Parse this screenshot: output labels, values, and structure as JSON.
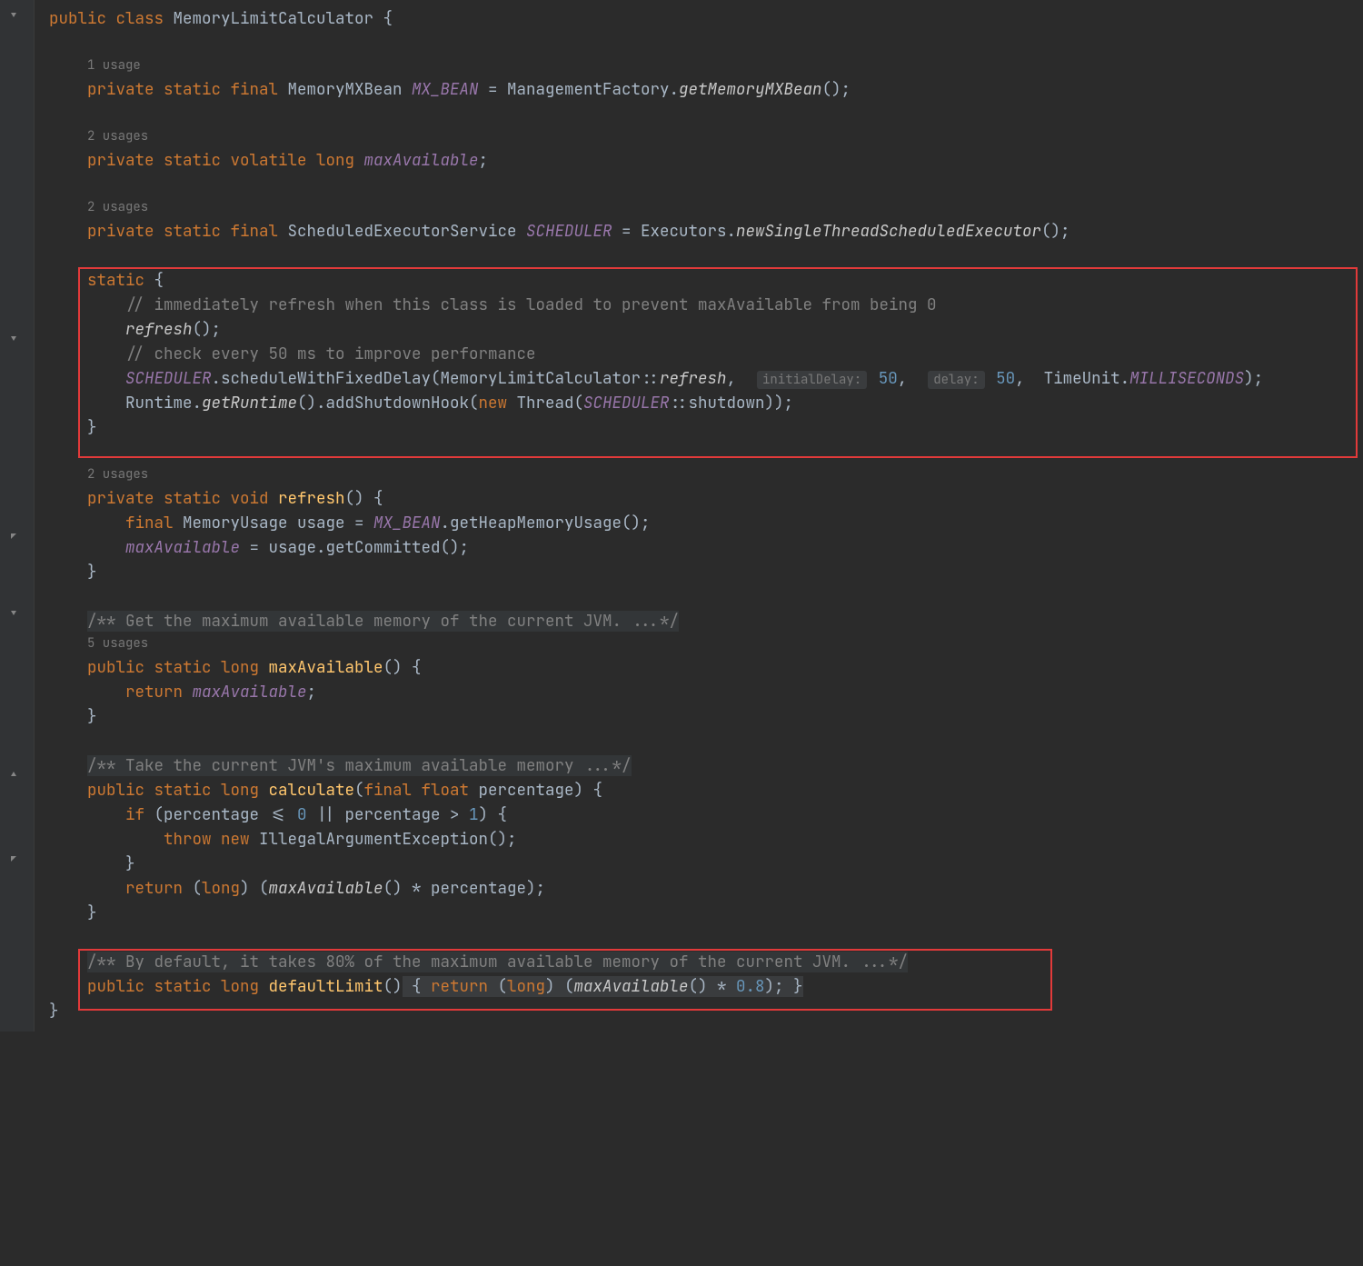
{
  "usages": {
    "u1": "1 usage",
    "u2a": "2 usages",
    "u2b": "2 usages",
    "u2c": "2 usages",
    "u5": "5 usages"
  },
  "code": {
    "l1_public": "public",
    "l1_class": "class",
    "l1_name": "MemoryLimitCalculator",
    "l1_brace": " {",
    "l3_private": "private",
    "l3_static": "static",
    "l3_final": "final",
    "l3_type": "MemoryMXBean",
    "l3_field": "MX_BEAN",
    "l3_eq": " = ",
    "l3_mgmt": "ManagementFactory",
    "l3_dot": ".",
    "l3_get": "getMemoryMXBean",
    "l3_tail": "();",
    "l5_private": "private",
    "l5_static": "static",
    "l5_volatile": "volatile",
    "l5_long": "long",
    "l5_field": "maxAvailable",
    "l5_tail": ";",
    "l7_private": "private",
    "l7_static": "static",
    "l7_final": "final",
    "l7_type": "ScheduledExecutorService",
    "l7_field": "SCHEDULER",
    "l7_eq": " = ",
    "l7_exec": "Executors",
    "l7_dot": ".",
    "l7_new": "newSingleThreadScheduledExecutor",
    "l7_tail": "();",
    "l9_static": "static",
    "l9_brace": " {",
    "l10_comment": "// immediately refresh when this class is loaded to prevent maxAvailable from being 0",
    "l11_refresh": "refresh",
    "l11_tail": "();",
    "l12_comment": "// check every 50 ms to improve performance",
    "l13_sched": "SCHEDULER",
    "l13_dot": ".",
    "l13_method": "scheduleWithFixedDelay",
    "l13_open": "(",
    "l13_mlc": "MemoryLimitCalculator",
    "l13_ref": "::",
    "l13_refresh": "refresh",
    "l13_c1": ",  ",
    "l13_hint1": "initialDelay:",
    "l13_v1": "50",
    "l13_c2": ",  ",
    "l13_hint2": "delay:",
    "l13_v2": "50",
    "l13_c3": ",  ",
    "l13_tu": "TimeUnit",
    "l13_dot2": ".",
    "l13_ms": "MILLISECONDS",
    "l13_close": ");",
    "l14_rt": "Runtime",
    "l14_dot": ".",
    "l14_getrt": "getRuntime",
    "l14_p1": "().",
    "l14_add": "addShutdownHook",
    "l14_open": "(",
    "l14_new": "new",
    "l14_thread": " Thread(",
    "l14_sched": "SCHEDULER",
    "l14_ref": "::",
    "l14_shut": "shutdown",
    "l14_close": "));",
    "l15_brace": "}",
    "l17_private": "private",
    "l17_static": "static",
    "l17_void": "void",
    "l17_name": "refresh",
    "l17_tail": "() {",
    "l18_final": "final",
    "l18_type": " MemoryUsage usage = ",
    "l18_mx": "MX_BEAN",
    "l18_dot": ".",
    "l18_get": "getHeapMemoryUsage",
    "l18_tail": "();",
    "l19_field": "maxAvailable",
    "l19_eq": " = usage.",
    "l19_get": "getCommitted",
    "l19_tail": "();",
    "l20_brace": "}",
    "l22_doc": "/** Get the maximum available memory of the current JVM. ...*/",
    "l23_public": "public",
    "l23_static": "static",
    "l23_long": "long",
    "l23_name": "maxAvailable",
    "l23_tail": "() {",
    "l24_return": "return",
    "l24_field": "maxAvailable",
    "l24_tail": ";",
    "l25_brace": "}",
    "l27_doc": "/** Take the current JVM's maximum available memory ...*/",
    "l28_public": "public",
    "l28_static": "static",
    "l28_long": "long",
    "l28_name": "calculate",
    "l28_open": "(",
    "l28_final": "final",
    "l28_float": "float",
    "l28_param": " percentage) {",
    "l29_if": "if",
    "l29_cond1": " (percentage <= ",
    "l29_zero": "0",
    "l29_or": " || percentage > ",
    "l29_one": "1",
    "l29_close": ") {",
    "l30_throw": "throw",
    "l30_new": "new",
    "l30_iae": " IllegalArgumentException();",
    "l31_brace": "}",
    "l32_return": "return",
    "l32_cast": " (",
    "l32_long": "long",
    "l32_close": ") (",
    "l32_maxav": "maxAvailable",
    "l32_tail": "() * percentage);",
    "l33_brace": "}",
    "l35_doc": "/** By default, it takes 80% of the maximum available memory of the current JVM. ...*/",
    "l36_public": "public",
    "l36_static": "static",
    "l36_long": "long",
    "l36_name": "defaultLimit",
    "l36_open": "()",
    "l36_fold1": " { ",
    "l36_return": "return",
    "l36_cast": " (",
    "l36_longc": "long",
    "l36_close": ") (",
    "l36_maxav": "maxAvailable",
    "l36_mul": "() * ",
    "l36_val": "0.8",
    "l36_tail": ");",
    "l36_fold2": " }",
    "l37_brace": "}"
  }
}
